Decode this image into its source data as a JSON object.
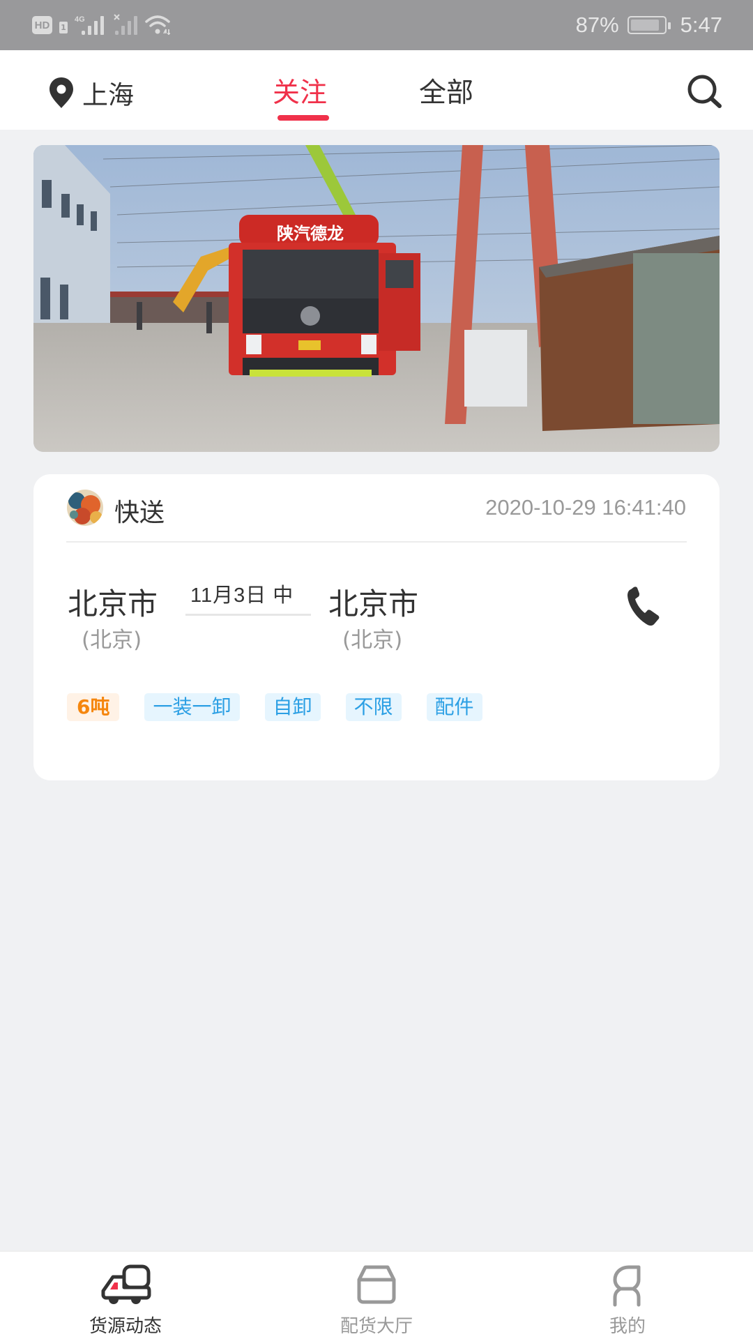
{
  "status_bar": {
    "left_indicators": [
      "hd-icon",
      "sim-1-icon",
      "signal-4g-icon",
      "signal-no-service-icon",
      "wifi-icon"
    ],
    "network_label": "4G",
    "hd_label": "HD",
    "sim_label": "1",
    "battery_percent": "87%",
    "battery_level": 0.87,
    "time": "5:47"
  },
  "header": {
    "location": "上海",
    "tabs": [
      {
        "label": "关注",
        "active": true
      },
      {
        "label": "全部",
        "active": false
      }
    ],
    "search_icon": "search-icon"
  },
  "banner": {
    "image_description": "Red Shaanxi Delong (陕汽德龙) truck in an industrial yard with cranes",
    "truck_text": "陕汽德龙"
  },
  "cargo_card": {
    "sender": "快送",
    "timestamp": "2020-10-29 16:41:40",
    "from_city": "北京市",
    "from_province": "(北京)",
    "date": "11月3日 中",
    "to_city": "北京市",
    "to_province": "(北京)",
    "tags": [
      {
        "label": "6吨",
        "type": "weight"
      },
      {
        "label": "一装一卸",
        "type": "info"
      },
      {
        "label": "自卸",
        "type": "info"
      },
      {
        "label": "不限",
        "type": "info"
      },
      {
        "label": "配件",
        "type": "info"
      }
    ]
  },
  "tabbar": {
    "items": [
      {
        "label": "货源动态",
        "icon": "truck-icon",
        "active": true
      },
      {
        "label": "配货大厅",
        "icon": "box-icon",
        "active": false
      },
      {
        "label": "我的",
        "icon": "person-icon",
        "active": false
      }
    ]
  },
  "colors": {
    "accent": "#f0314a",
    "background": "#f0f1f3",
    "status_bar": "#99999b",
    "tag_blue_text": "#2b9fe4",
    "tag_blue_bg": "#e6f5fe",
    "tag_orange_text": "#f5860d",
    "tag_orange_bg": "#fff2e6"
  }
}
